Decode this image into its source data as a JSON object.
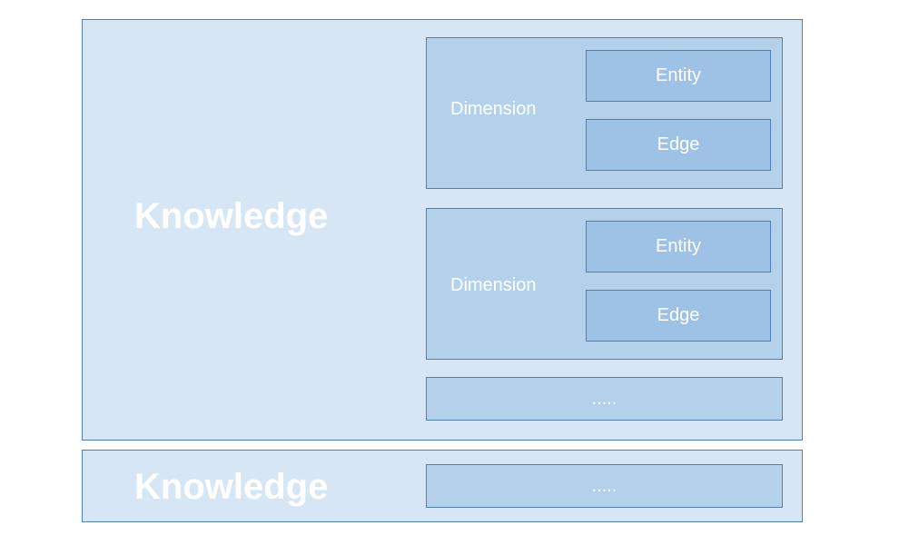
{
  "groups": [
    {
      "label": "Knowledge",
      "dimensions": [
        {
          "label": "Dimension",
          "children": [
            "Entity",
            "Edge"
          ]
        },
        {
          "label": "Dimension",
          "children": [
            "Entity",
            "Edge"
          ]
        }
      ],
      "more": "....."
    },
    {
      "label": "Knowledge",
      "more": "....."
    }
  ]
}
